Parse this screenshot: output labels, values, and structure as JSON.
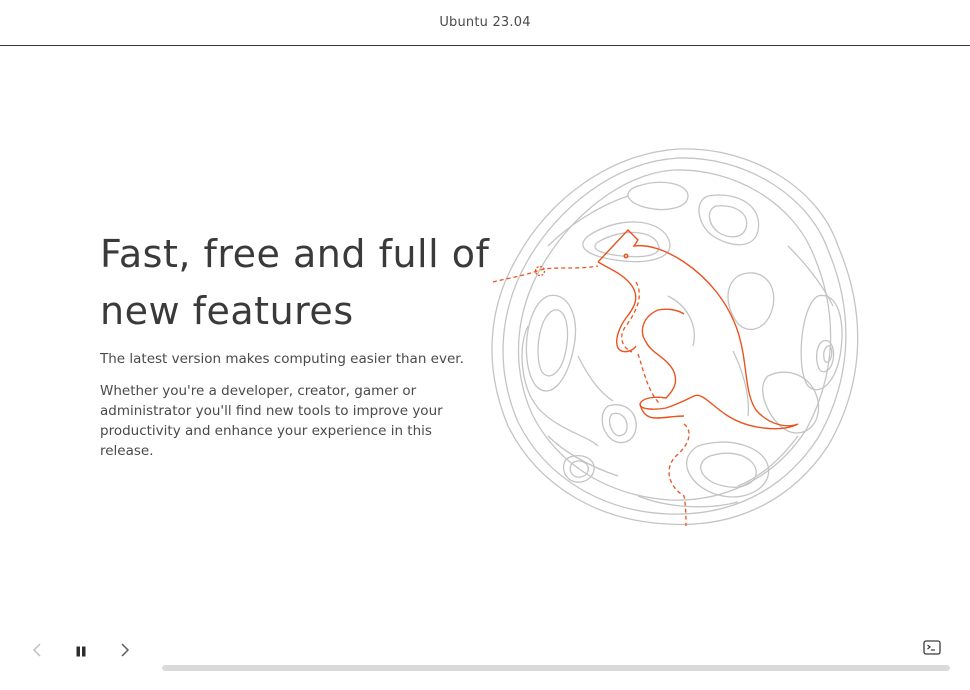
{
  "window": {
    "title": "Ubuntu 23.04"
  },
  "slide": {
    "headline": "Fast, free and full of new features",
    "lead": "The latest version makes computing easier than ever.",
    "body": "Whether you're a developer, creator, gamer or administrator you'll find new tools to improve your productivity and enhance your experience in this release."
  },
  "controls": {
    "prev_icon": "chevron-left-icon",
    "pause_icon": "pause-icon",
    "next_icon": "chevron-right-icon",
    "terminal_icon": "terminal-icon"
  },
  "progress": {
    "value": 0
  },
  "colors": {
    "accent": "#e95420",
    "text": "#3d3d3d",
    "illustration_line": "#bdbdbd",
    "progress_track": "#dadada"
  }
}
